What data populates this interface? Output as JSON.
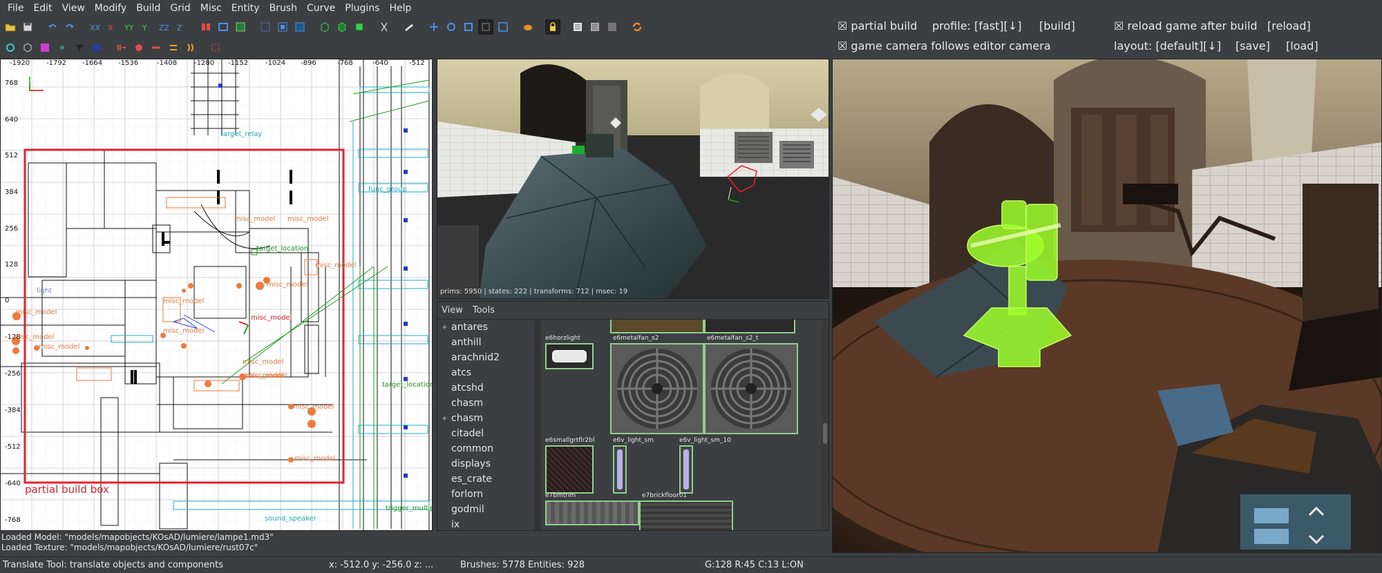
{
  "menu": [
    "File",
    "Edit",
    "View",
    "Modify",
    "Build",
    "Grid",
    "Misc",
    "Entity",
    "Brush",
    "Curve",
    "Plugins",
    "Help"
  ],
  "options": {
    "partial_build": "☒ partial build",
    "profile": "profile: [fast][↓]",
    "build": "[build]",
    "reload_game": "☒ reload game after build",
    "reload": "[reload]",
    "camera_follows": "☒ game camera follows editor camera",
    "layout": "layout: [default][↓]",
    "save": "[save]",
    "load": "[load]"
  },
  "grid2d": {
    "x_ticks": [
      "-1920",
      "-1792",
      "-1664",
      "-1536",
      "-1408",
      "-1280",
      "-1152",
      "-1024",
      "-896",
      "-768",
      "-640",
      "-512"
    ],
    "y_ticks": [
      "768",
      "640",
      "512",
      "384",
      "256",
      "128",
      "0",
      "-128",
      "-256",
      "-384",
      "-512",
      "-640",
      "-768"
    ],
    "partial_build_label": "partial build box",
    "entity_labels": [
      "misc_model",
      "misc_model",
      "misc_model",
      "misc_model",
      "misc_model",
      "misc_model",
      "misc_model",
      "misc_model",
      "misc_model",
      "misc_model",
      "target_location",
      "target_location",
      "light",
      "misc_model",
      "misc_model",
      "misc_model",
      "misc_model",
      "misc_model",
      "func_group",
      "sound_speaker",
      "target_relay",
      "trigger_multiple"
    ]
  },
  "render_stats": "prims: 5950 | states: 222 | transforms: 712 | msec: 19",
  "browser": {
    "tabs": [
      "View",
      "Tools"
    ],
    "tree": [
      {
        "label": "antares",
        "expander": "+"
      },
      {
        "label": "anthill",
        "expander": ""
      },
      {
        "label": "arachnid2",
        "expander": ""
      },
      {
        "label": "atcs",
        "expander": ""
      },
      {
        "label": "atcshd",
        "expander": ""
      },
      {
        "label": "chasm",
        "expander": ""
      },
      {
        "label": "chasm",
        "expander": "+"
      },
      {
        "label": "citadel",
        "expander": ""
      },
      {
        "label": "common",
        "expander": ""
      },
      {
        "label": "displays",
        "expander": ""
      },
      {
        "label": "es_crate",
        "expander": ""
      },
      {
        "label": "forlorn",
        "expander": ""
      },
      {
        "label": "godmil",
        "expander": ""
      },
      {
        "label": "ix",
        "expander": ""
      }
    ],
    "textures": [
      "e6horzlight",
      "e6metalfan_s2",
      "e6metalfan_s2_t",
      "e6smallgrtflr2bl",
      "e6v_light_sm",
      "e6v_light_sm_10",
      "e7bmtrim",
      "e7brickfloor01"
    ]
  },
  "console": [
    "Loaded Model: \"models/mapobjects/KOsAD/lumiere/lampe1.md3\"",
    "Loaded Texture: \"models/mapobjects/KOsAD/lumiere/rust07c\""
  ],
  "status": {
    "tool": "Translate Tool: translate objects and components",
    "coords": "x: -512.0  y: -256.0  z:  ...",
    "counts": "Brushes: 5778 Entities: 928",
    "grid": "G:128  R:45  C:13  L:ON"
  },
  "colors": {
    "chrome": "#3c3f41",
    "selection": "#e8202a",
    "entity_orange": "#f07a3a",
    "entity_green": "#1aa01a",
    "entity_cyan": "#1ab0c8",
    "texture_border": "#8fd08f",
    "highlight_green": "#9dff2a"
  },
  "icons": [
    "open-icon",
    "save-icon",
    "undo-icon",
    "redo-icon",
    "flip-x-icon",
    "flip-y-icon",
    "rotate-x-icon",
    "rotate-y-icon",
    "rotate-z-icon",
    "select-icon",
    "clipper-icon",
    "camera-icon",
    "texture-lock-icon",
    "refresh-icon"
  ]
}
